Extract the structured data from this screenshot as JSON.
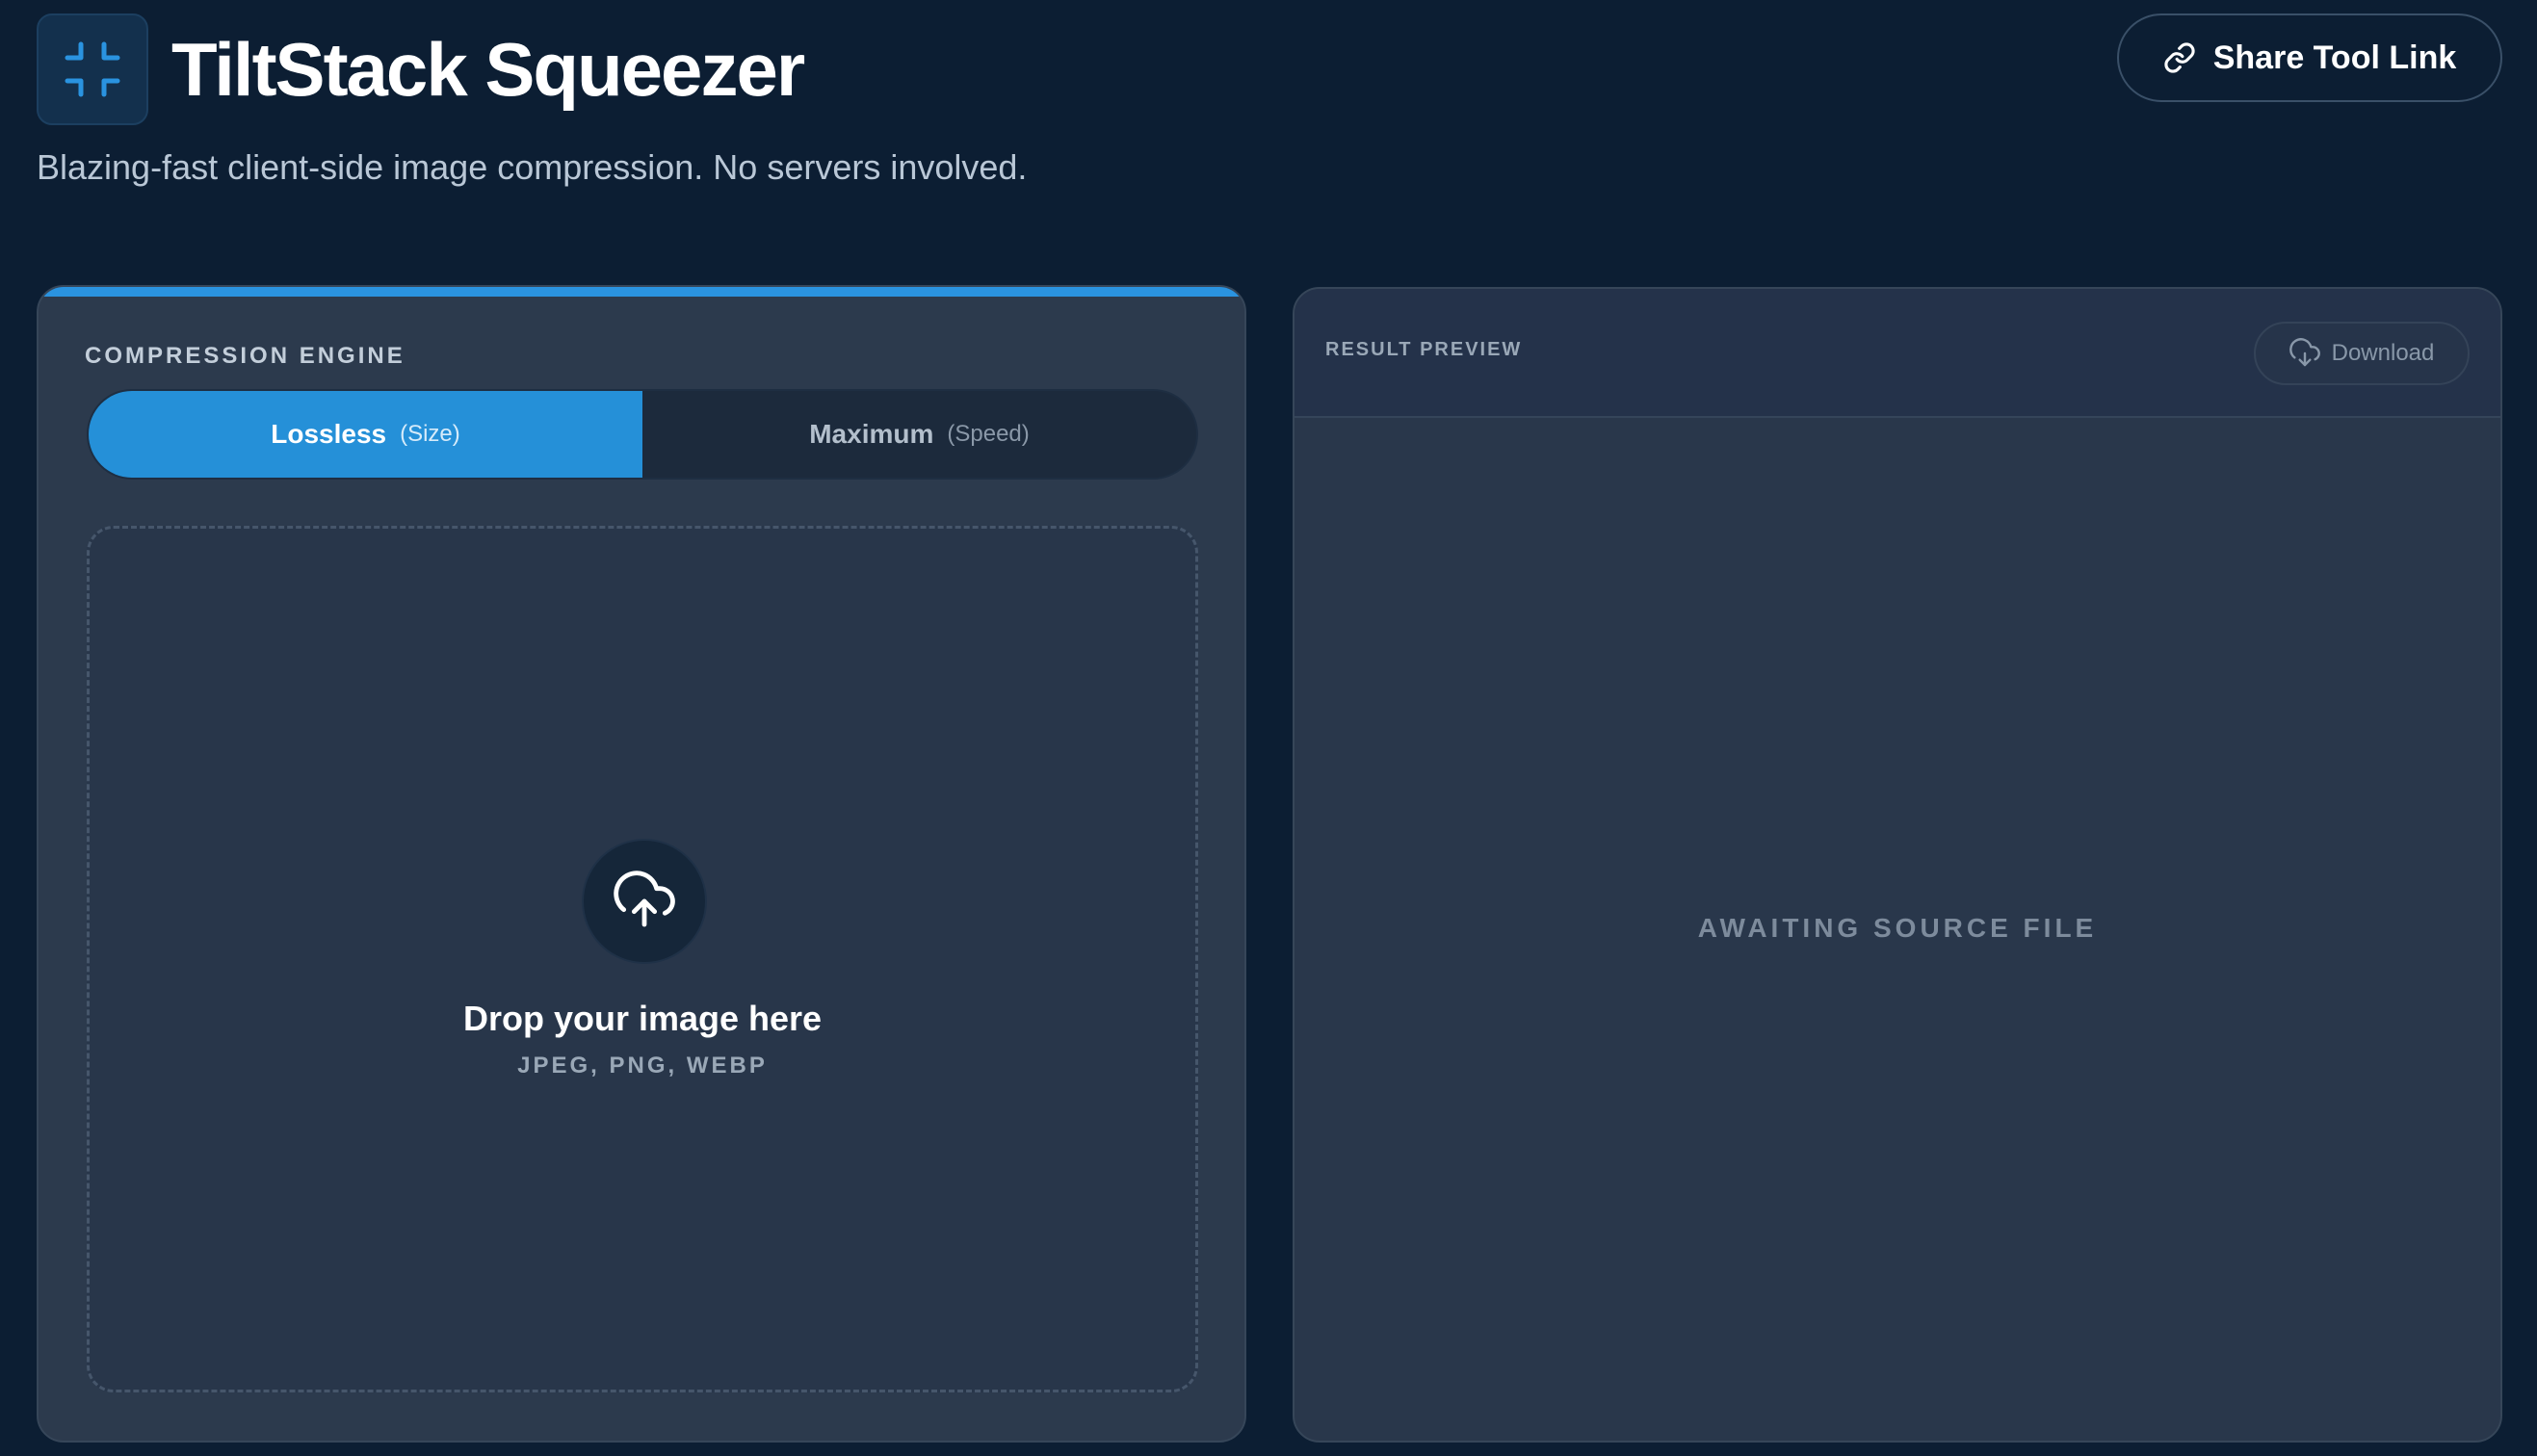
{
  "header": {
    "title": "TiltStack Squeezer",
    "subtitle": "Blazing-fast client-side image compression. No servers involved.",
    "share_label": "Share Tool Link",
    "logo_icon": "compress-icon",
    "share_icon": "link-icon"
  },
  "engine": {
    "label": "COMPRESSION ENGINE",
    "options": [
      {
        "label": "Lossless",
        "sub": "(Size)",
        "selected": true
      },
      {
        "label": "Maximum",
        "sub": "(Speed)",
        "selected": false
      }
    ]
  },
  "dropzone": {
    "icon": "cloud-upload-icon",
    "title": "Drop your image here",
    "formats": "JPEG, PNG, WEBP"
  },
  "preview": {
    "label": "RESULT PREVIEW",
    "download_label": "Download",
    "download_icon": "cloud-download-icon",
    "status": "AWAITING SOURCE FILE"
  },
  "colors": {
    "background": "#0c1e33",
    "accent": "#2590d8",
    "panel": "#2c3a4d"
  }
}
